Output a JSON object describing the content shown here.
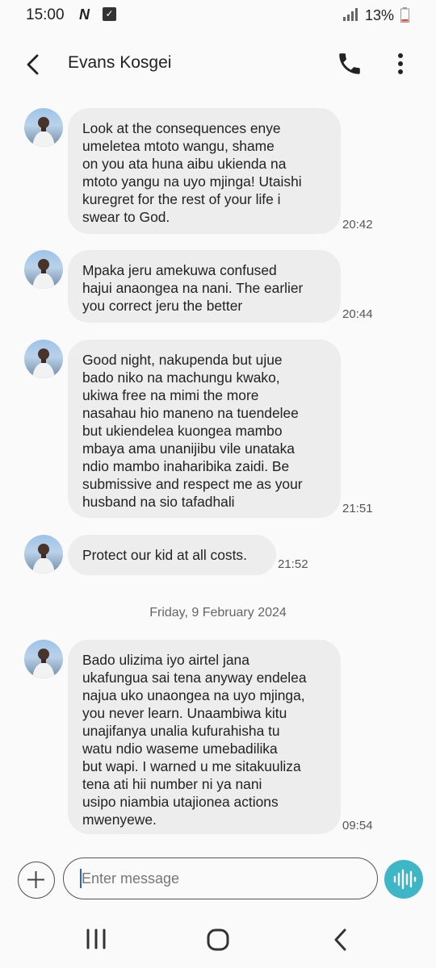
{
  "status_bar": {
    "time": "15:00",
    "battery": "13%"
  },
  "header": {
    "contact_name": "Evans Kosgei"
  },
  "messages": [
    {
      "text": "Look at the consequences enye\numeletea mtoto wangu, shame\non you ata huna aibu ukienda na\nmtoto yangu na uyo mjinga! Utaishi\nkuregret for the rest of your life i\nswear to God.",
      "time": "20:42"
    },
    {
      "text": "Mpaka jeru amekuwa confused\nhajui anaongea na nani. The earlier\nyou correct jeru the better",
      "time": "20:44"
    },
    {
      "text": "Good night, nakupenda but ujue\nbado niko na machungu kwako,\nukiwa free na mimi the more\nnasahau hio maneno na tuendelee\nbut ukiendelea kuongea mambo\nmbaya ama unanijibu vile unataka\nndio mambo inaharibika zaidi. Be\nsubmissive and respect me as your\nhusband na sio tafadhali",
      "time": "21:51"
    },
    {
      "text": "Protect our kid at all costs.",
      "time": "21:52"
    },
    {
      "text": "Bado ulizima iyo airtel jana\nukafungua sai tena anyway endelea\nnajua uko unaongea na uyo mjinga,\nyou never learn. Unaambiwa kitu\nunajifanya unalia kufurahisha tu\nwatu ndio waseme umebadilika\nbut wapi. I warned u me sitakuuliza\ntena ati hii number ni ya nani\nusipo niambia utajionea actions\nmwenyewe.",
      "time": "09:54"
    }
  ],
  "date_separator": "Friday, 9 February 2024",
  "composer": {
    "placeholder": "Enter message"
  },
  "colors": {
    "bubble": "#ededed",
    "accent": "#3eb6c5",
    "background": "#fafafa"
  },
  "icons": [
    "back-arrow-icon",
    "phone-icon",
    "more-vert-icon",
    "plus-icon",
    "voice-wave-icon",
    "recents-icon",
    "home-icon",
    "nav-back-icon"
  ]
}
